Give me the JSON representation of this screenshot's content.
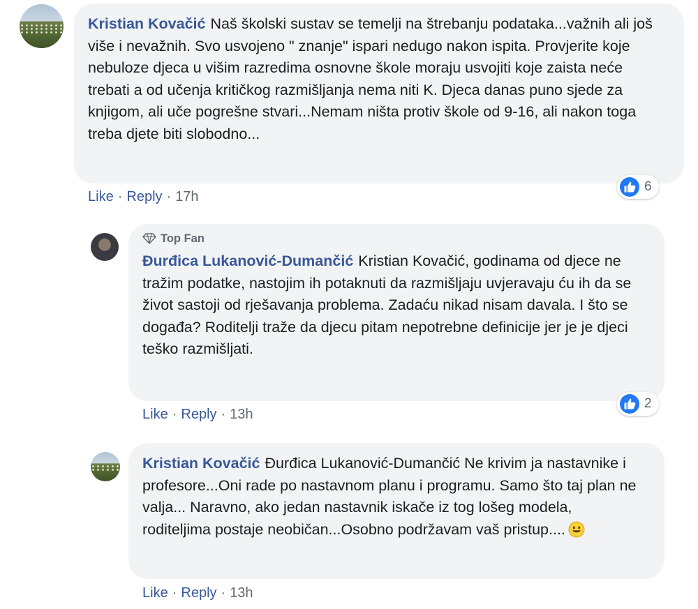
{
  "comments": [
    {
      "author": "Kristian Kovačić",
      "text": "Naš školski sustav se temelji na štrebanju podataka...važnih ali još više i nevažnih. Svo usvojeno \" znanje\" ispari nedugo nakon ispita. Provjerite koje nebuloze djeca u višim razredima osnovne škole moraju usvojiti koje zaista neće trebati a od učenja kritičkog razmišljanja nema niti K. Djeca danas puno sjede za knjigom, ali uče pogrešne stvari...Nemam ništa protiv škole od 9-16, ali nakon toga treba djete biti slobodno...",
      "like_label": "Like",
      "reply_label": "Reply",
      "time": "17h",
      "reaction_count": "6"
    },
    {
      "badge": "Top Fan",
      "author": "Đurđica Lukanović-Dumančić",
      "text": "Kristian Kovačić, godinama od djece ne tražim podatke, nastojim ih potaknuti da razmišljaju uvjeravaju ću ih da se život sastoji od rješavanja problema. Zadaću nikad nisam davala. I što se događa? Roditelji traže da djecu pitam nepotrebne definicije jer je je djeci teško razmišljati.",
      "like_label": "Like",
      "reply_label": "Reply",
      "time": "13h",
      "reaction_count": "2"
    },
    {
      "author": "Kristian Kovačić",
      "text": "Đurđica Lukanović-Dumančić Ne krivim ja nastavnike i profesore...Oni rade po nastavnom planu i programu. Samo što taj plan ne valja... Naravno, ako jedan nastavnik iskače iz tog lošeg modela, roditeljima postaje neobičan...Osobno podržavam vaš pristup....",
      "emoji": "smiling-face",
      "like_label": "Like",
      "reply_label": "Reply",
      "time": "13h"
    }
  ],
  "separator": "·",
  "colors": {
    "link": "#385898",
    "bubble": "#f2f3f5",
    "meta": "#606770",
    "like_blue": "#2078f4"
  }
}
